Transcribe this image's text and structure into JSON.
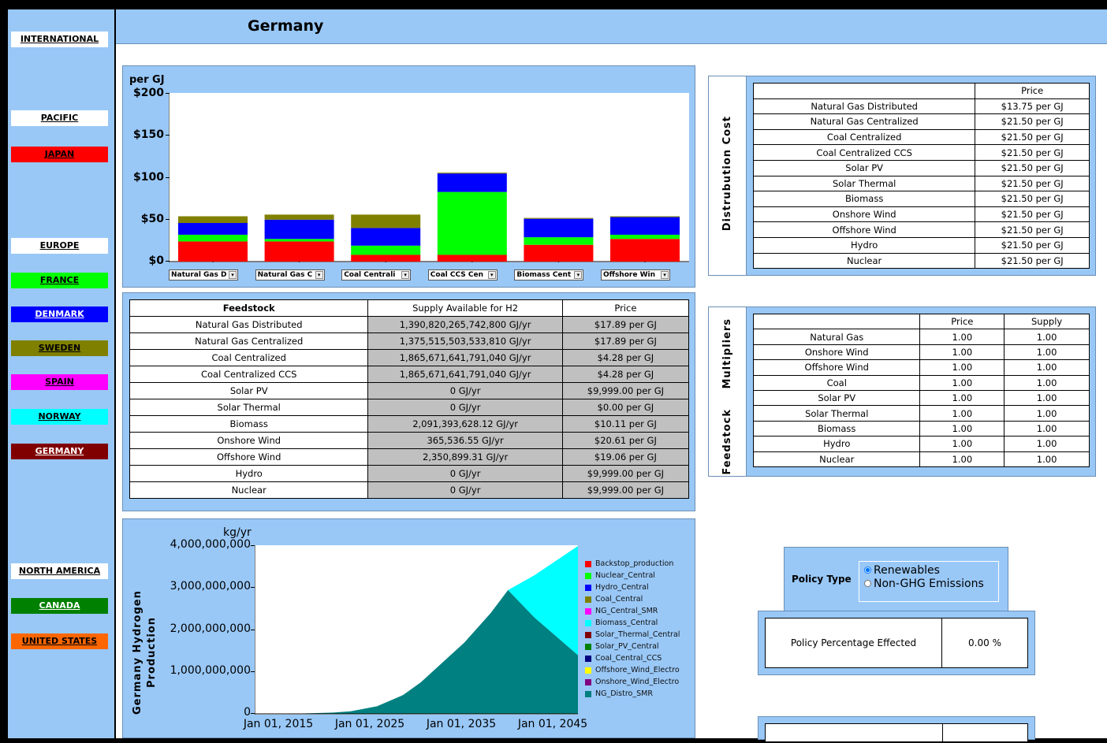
{
  "header": {
    "title": "Germany"
  },
  "nav": [
    {
      "id": "international",
      "label": "INTERNATIONAL",
      "style": "white",
      "top": 40
    },
    {
      "id": "pacific",
      "label": "PACIFIC",
      "style": "white",
      "top": 140
    },
    {
      "id": "japan",
      "label": "JAPAN",
      "bg": "#ff0000",
      "color": "#000000",
      "top": 186
    },
    {
      "id": "europe",
      "label": "EUROPE",
      "style": "white",
      "top": 302
    },
    {
      "id": "france",
      "label": "FRANCE",
      "bg": "#00ff00",
      "color": "#000000",
      "top": 346
    },
    {
      "id": "denmark",
      "label": "DENMARK",
      "bg": "#0000ff",
      "color": "#ffffff",
      "top": 389
    },
    {
      "id": "sweden",
      "label": "SWEDEN",
      "bg": "#808000",
      "color": "#000000",
      "top": 432
    },
    {
      "id": "spain",
      "label": "SPAIN",
      "bg": "#ff00ff",
      "color": "#000000",
      "top": 475
    },
    {
      "id": "norway",
      "label": "NORWAY",
      "bg": "#00ffff",
      "color": "#000000",
      "top": 519
    },
    {
      "id": "germany",
      "label": "GERMANY",
      "bg": "#800000",
      "color": "#ffffff",
      "top": 563
    },
    {
      "id": "north-america",
      "label": "NORTH AMERICA",
      "style": "white",
      "top": 715
    },
    {
      "id": "canada",
      "label": "CANADA",
      "bg": "#008000",
      "color": "#ffffff",
      "top": 759
    },
    {
      "id": "united-states",
      "label": "UNITED STATES",
      "bg": "#ff6600",
      "color": "#000000",
      "top": 804
    }
  ],
  "cost_chart": {
    "unit_label": "per GJ",
    "y_ticks": [
      "$200",
      "$150",
      "$100",
      "$50",
      "$0"
    ],
    "dropdowns": [
      "Natural Gas D",
      "Natural Gas C",
      "Coal Centrali",
      "Coal CCS Cen",
      "Biomass Cent",
      "Offshore Win"
    ]
  },
  "chart_data": [
    {
      "type": "bar",
      "stacked": true,
      "categories": [
        "Natural Gas Distributed",
        "Natural Gas Centralized",
        "Coal Centralized",
        "Coal CCS Centralized",
        "Biomass Central",
        "Offshore Wind"
      ],
      "ylim": [
        0,
        200
      ],
      "ylabel": "per GJ",
      "series": [
        {
          "color": "#ff0000",
          "values": [
            24,
            24,
            8,
            8,
            20,
            27
          ]
        },
        {
          "color": "#00ff00",
          "values": [
            8,
            3,
            11,
            75,
            9,
            5
          ]
        },
        {
          "color": "#0000ff",
          "values": [
            14,
            23,
            21,
            22,
            22,
            21
          ]
        },
        {
          "color": "#808000",
          "values": [
            8,
            6,
            16,
            1,
            1,
            1
          ]
        }
      ]
    },
    {
      "type": "area",
      "stacked": true,
      "ylabel": "Germany Hydrogen Production",
      "unit_label": "kg/yr",
      "ylim": [
        0,
        4000000000
      ],
      "y_ticks": [
        "4,000,000,000",
        "3,000,000,000",
        "2,000,000,000",
        "1,000,000,000",
        "0"
      ],
      "x_ticks": [
        "Jan 01, 2015",
        "Jan 01, 2025",
        "Jan 01, 2035",
        "Jan 01, 2045"
      ],
      "x": [
        2013,
        2015,
        2020,
        2022,
        2025,
        2028,
        2030,
        2035,
        2038,
        2040,
        2043,
        2048
      ],
      "series": [
        {
          "name": "NG_Distro_SMR",
          "color": "#008080",
          "values": [
            0,
            0,
            30000000,
            60000000,
            180000000,
            450000000,
            750000000,
            1700000000,
            2400000000,
            2950000000,
            2300000000,
            1400000000
          ]
        },
        {
          "name": "Biomass_Central",
          "color": "#00ffff",
          "values": [
            0,
            0,
            0,
            0,
            0,
            0,
            0,
            0,
            0,
            0,
            1000000000,
            2600000000
          ]
        }
      ],
      "legend": [
        {
          "name": "Backstop_production",
          "color": "#ff0000"
        },
        {
          "name": "Nuclear_Central",
          "color": "#00ff00"
        },
        {
          "name": "Hydro_Central",
          "color": "#0000ff"
        },
        {
          "name": "Coal_Central",
          "color": "#808000"
        },
        {
          "name": "NG_Central_SMR",
          "color": "#ff00ff"
        },
        {
          "name": "Biomass_Central",
          "color": "#00ffff"
        },
        {
          "name": "Solar_Thermal_Central",
          "color": "#800000"
        },
        {
          "name": "Solar_PV_Central",
          "color": "#008000"
        },
        {
          "name": "Coal_Central_CCS",
          "color": "#000080"
        },
        {
          "name": "Offshore_Wind_Electro",
          "color": "#ffff00"
        },
        {
          "name": "Onshore_Wind_Electro",
          "color": "#800080"
        },
        {
          "name": "NG_Distro_SMR",
          "color": "#008080"
        }
      ]
    }
  ],
  "feedstock_table": {
    "headers": [
      "Feedstock",
      "Supply Available for H2",
      "Price"
    ],
    "rows": [
      [
        "Natural Gas Distributed",
        "1,390,820,265,742,800 GJ/yr",
        "$17.89 per GJ"
      ],
      [
        "Natural Gas Centralized",
        "1,375,515,503,533,810 GJ/yr",
        "$17.89 per GJ"
      ],
      [
        "Coal Centralized",
        "1,865,671,641,791,040 GJ/yr",
        "$4.28 per GJ"
      ],
      [
        "Coal Centralized CCS",
        "1,865,671,641,791,040 GJ/yr",
        "$4.28 per GJ"
      ],
      [
        "Solar PV",
        "0 GJ/yr",
        "$9,999.00 per GJ"
      ],
      [
        "Solar Thermal",
        "0 GJ/yr",
        "$0.00 per GJ"
      ],
      [
        "Biomass",
        "2,091,393,628.12 GJ/yr",
        "$10.11 per GJ"
      ],
      [
        "Onshore Wind",
        "365,536.55 GJ/yr",
        "$20.61 per GJ"
      ],
      [
        "Offshore Wind",
        "2,350,899.31 GJ/yr",
        "$19.06 per GJ"
      ],
      [
        "Hydro",
        "0 GJ/yr",
        "$9,999.00 per GJ"
      ],
      [
        "Nuclear",
        "0 GJ/yr",
        "$9,999.00 per GJ"
      ]
    ]
  },
  "distribution_cost": {
    "side_label": "Distrubution Cost",
    "headers": [
      "",
      "Price"
    ],
    "rows": [
      [
        "Natural Gas Distributed",
        "$13.75 per GJ"
      ],
      [
        "Natural Gas Centralized",
        "$21.50 per GJ"
      ],
      [
        "Coal Centralized",
        "$21.50 per GJ"
      ],
      [
        "Coal Centralized CCS",
        "$21.50 per GJ"
      ],
      [
        "Solar PV",
        "$21.50 per GJ"
      ],
      [
        "Solar Thermal",
        "$21.50 per GJ"
      ],
      [
        "Biomass",
        "$21.50 per GJ"
      ],
      [
        "Onshore Wind",
        "$21.50 per GJ"
      ],
      [
        "Offshore Wind",
        "$21.50 per GJ"
      ],
      [
        "Hydro",
        "$21.50 per GJ"
      ],
      [
        "Nuclear",
        "$21.50 per GJ"
      ]
    ]
  },
  "multipliers": {
    "side_label": "Feedstock Multipliers",
    "headers": [
      "",
      "Price",
      "Supply"
    ],
    "rows": [
      [
        "Natural Gas",
        "1.00",
        "1.00"
      ],
      [
        "Onshore Wind",
        "1.00",
        "1.00"
      ],
      [
        "Offshore Wind",
        "1.00",
        "1.00"
      ],
      [
        "Coal",
        "1.00",
        "1.00"
      ],
      [
        "Solar PV",
        "1.00",
        "1.00"
      ],
      [
        "Solar Thermal",
        "1.00",
        "1.00"
      ],
      [
        "Biomass",
        "1.00",
        "1.00"
      ],
      [
        "Hydro",
        "1.00",
        "1.00"
      ],
      [
        "Nuclear",
        "1.00",
        "1.00"
      ]
    ]
  },
  "policy": {
    "type_label": "Policy Type",
    "options": [
      "Renewables",
      "Non-GHG Emissions"
    ],
    "selected": "Renewables",
    "percentage_label": "Policy Percentage Effected",
    "percentage_value": "0.00 %"
  }
}
